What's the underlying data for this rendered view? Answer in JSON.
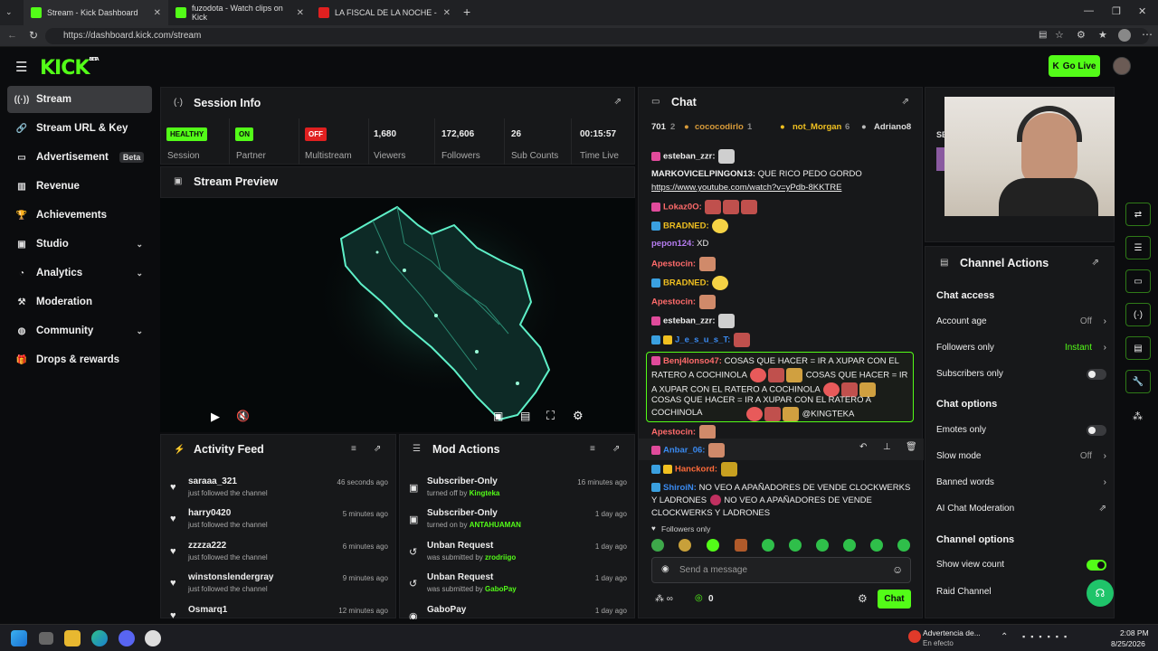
{
  "browser": {
    "tabs": [
      {
        "title": "Stream - Kick Dashboard"
      },
      {
        "title": "fuzodota - Watch clips on Kick"
      },
      {
        "title": "LA FISCAL DE LA NOCHE - PIURA"
      }
    ],
    "url": "https://dashboard.kick.com/stream"
  },
  "header": {
    "logo": "KICK",
    "logo_badge": "BETA",
    "go_live": "Go Live"
  },
  "sidebar": {
    "items": [
      {
        "label": "Stream",
        "icon": "broadcast-icon"
      },
      {
        "label": "Stream URL & Key",
        "icon": "link-icon"
      },
      {
        "label": "Advertisement",
        "icon": "monitor-icon",
        "badge": "Beta"
      },
      {
        "label": "Revenue",
        "icon": "chart-icon"
      },
      {
        "label": "Achievements",
        "icon": "trophy-icon"
      },
      {
        "label": "Studio",
        "icon": "studio-icon"
      },
      {
        "label": "Analytics",
        "icon": "analytics-icon"
      },
      {
        "label": "Moderation",
        "icon": "hammer-icon"
      },
      {
        "label": "Community",
        "icon": "community-icon"
      },
      {
        "label": "Drops & rewards",
        "icon": "gift-icon"
      }
    ]
  },
  "session": {
    "title": "Session Info",
    "session_status": "HEALTHY",
    "session_label": "Session",
    "partner_status": "ON",
    "partner_label": "Partner",
    "multistream_status": "OFF",
    "multistream_label": "Multistream",
    "viewers": "1,680",
    "viewers_label": "Viewers",
    "followers": "172,606",
    "followers_label": "Followers",
    "subs": "26",
    "subs_label": "Sub Counts",
    "time_live": "00:15:57",
    "time_label": "Time Live"
  },
  "preview": {
    "title": "Stream Preview"
  },
  "activity": {
    "title": "Activity Feed",
    "rows": [
      {
        "name": "saraaa_321",
        "sub": "just followed the channel",
        "time": "46 seconds ago"
      },
      {
        "name": "harry0420",
        "sub": "just followed the channel",
        "time": "5 minutes ago"
      },
      {
        "name": "zzzza222",
        "sub": "just followed the channel",
        "time": "6 minutes ago"
      },
      {
        "name": "winstonslendergray",
        "sub": "just followed the channel",
        "time": "9 minutes ago"
      },
      {
        "name": "Osmarq1",
        "sub": "",
        "time": "12 minutes ago"
      }
    ]
  },
  "mod": {
    "title": "Mod Actions",
    "rows": [
      {
        "name": "Subscriber-Only",
        "sub": "turned off by",
        "who": "Kingteka",
        "time": "16 minutes ago"
      },
      {
        "name": "Subscriber-Only",
        "sub": "turned on by",
        "who": "ANTAHUAMAN",
        "time": "1 day ago"
      },
      {
        "name": "Unban Request",
        "sub": "was submitted by",
        "who": "zrodriigo",
        "time": "1 day ago"
      },
      {
        "name": "Unban Request",
        "sub": "was submitted by",
        "who": "GaboPay",
        "time": "1 day ago"
      },
      {
        "name": "GaboPay",
        "sub": "",
        "who": "",
        "time": "1 day ago"
      }
    ]
  },
  "chat": {
    "title": "Chat",
    "leaderboard": [
      {
        "count": "701",
        "rank": "2"
      },
      {
        "name": "cococodirlo",
        "num": "1"
      },
      {
        "name": "not_Morgan",
        "num": "6"
      },
      {
        "name": "Adriano8",
        "num": "2"
      }
    ],
    "messages": [
      {
        "name": "esteban_zzr:",
        "text": ""
      },
      {
        "name": "MARKOVICELPINGON13:",
        "text": "QUE RICO PEDO GORDO"
      },
      {
        "link": "https://www.youtube.com/watch?v=yPdb-8KKTRE"
      },
      {
        "name": "Lokaz0O:",
        "text": ""
      },
      {
        "name": "BRADNED:",
        "text": ""
      },
      {
        "name": "pepon124:",
        "text": "XD"
      },
      {
        "name": "Apestocin:",
        "text": ""
      },
      {
        "name": "BRADNED:",
        "text": ""
      },
      {
        "name": "Apestocin:",
        "text": ""
      },
      {
        "name": "esteban_zzr:",
        "text": ""
      },
      {
        "name": "J_e_s_u_s_T:",
        "text": ""
      },
      {
        "name": "Benj4lonso47:",
        "text": "COSAS QUE HACER = IR A XUPAR CON EL RATERO A COCHINOLA",
        "text2": "COSAS QUE HACER = IR A XUPAR CON EL RATERO A COCHINOLA",
        "text3": "COSAS QUE HACER = IR A XUPAR CON EL RATERO A COCHINOLA",
        "mention": "@KINGTEKA"
      },
      {
        "name": "Apestocin:",
        "text": ""
      },
      {
        "name": "Anbar_06:",
        "text": ""
      },
      {
        "name": "Hanckord:",
        "text": ""
      },
      {
        "name": "ShiroiN:",
        "text": "NO VEO A APAÑADORES DE VENDE CLOCKWERKS Y LADRONES",
        "text2": "NO VEO A APAÑADORES DE VENDE CLOCKWERKS Y LADRONES"
      }
    ],
    "followers_only": "Followers only",
    "input_placeholder": "Send a message",
    "points": "0",
    "send": "Chat"
  },
  "actions": {
    "title": "Channel Actions",
    "chat_access": "Chat access",
    "account_age": "Account age",
    "account_age_val": "Off",
    "followers_only": "Followers only",
    "followers_only_val": "Instant",
    "subscribers_only": "Subscribers only",
    "chat_options": "Chat options",
    "emotes_only": "Emotes only",
    "slow_mode": "Slow mode",
    "slow_mode_val": "Off",
    "banned_words": "Banned words",
    "ai_mod": "AI Chat Moderation",
    "channel_options": "Channel options",
    "show_view_count": "Show view count",
    "raid_channel": "Raid Channel",
    "cam_label": "SE"
  },
  "taskbar": {
    "notif_title": "Advertencia de...",
    "notif_sub": "En efecto",
    "time": "2:08 PM",
    "date": "8/25/2026"
  },
  "colors": {
    "accent": "#53fc18",
    "panel": "#17181a",
    "bg": "#0b0c0e"
  }
}
